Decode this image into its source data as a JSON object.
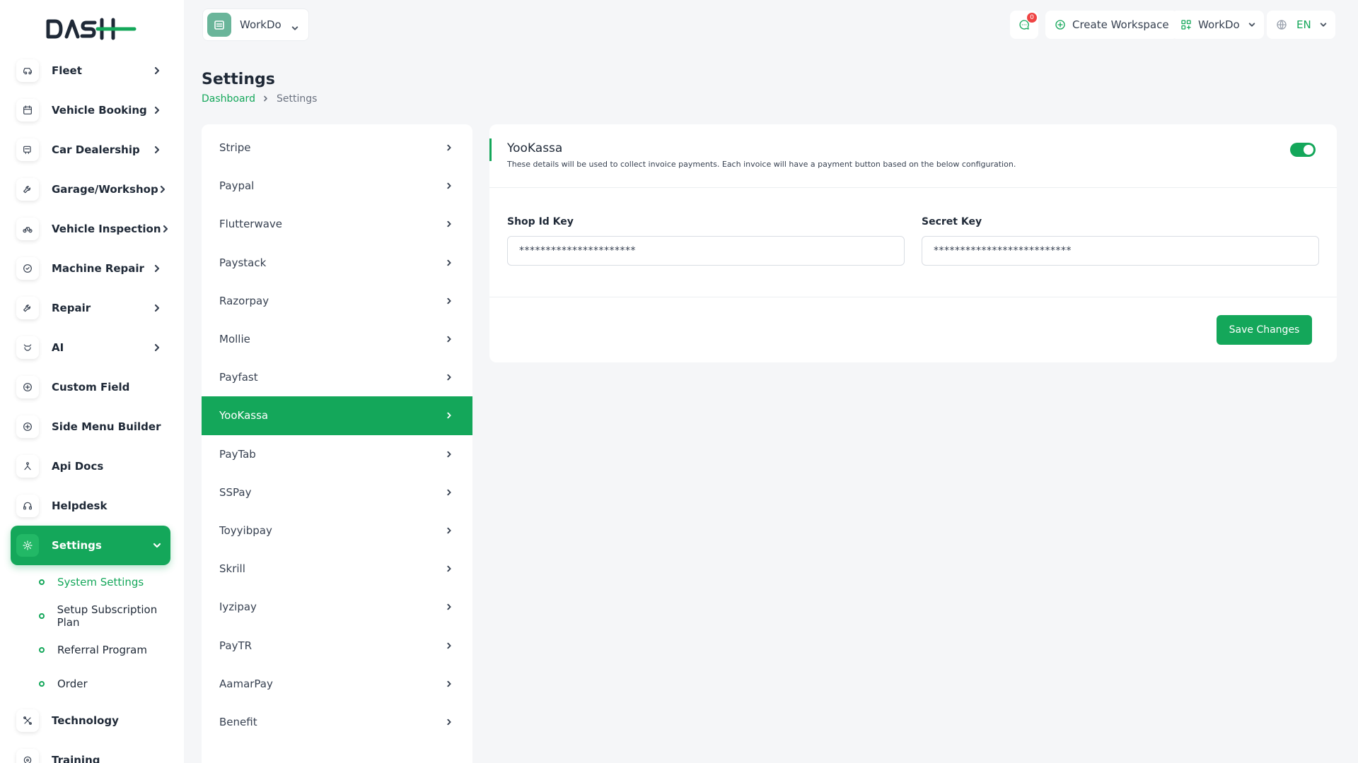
{
  "brand": {
    "logo_text": "DASH",
    "accent": "#14a75a"
  },
  "sidebar": {
    "items": [
      {
        "label": "Fleet",
        "icon": "car-icon",
        "has_children": true
      },
      {
        "label": "Vehicle Booking",
        "icon": "calendar-icon",
        "has_children": true
      },
      {
        "label": "Car Dealership",
        "icon": "dealership-icon",
        "has_children": true
      },
      {
        "label": "Garage/Workshop",
        "icon": "wrench-icon",
        "has_children": true
      },
      {
        "label": "Vehicle Inspection",
        "icon": "bike-icon",
        "has_children": true
      },
      {
        "label": "Machine Repair",
        "icon": "machine-icon",
        "has_children": true
      },
      {
        "label": "Repair",
        "icon": "repair-icon",
        "has_children": true
      },
      {
        "label": "AI",
        "icon": "ai-icon",
        "has_children": true
      },
      {
        "label": "Custom Field",
        "icon": "plus-circle-icon",
        "has_children": false
      },
      {
        "label": "Side Menu Builder",
        "icon": "plus-circle-icon",
        "has_children": false
      },
      {
        "label": "Api Docs",
        "icon": "api-icon",
        "has_children": false
      },
      {
        "label": "Helpdesk",
        "icon": "headset-icon",
        "has_children": false
      },
      {
        "label": "Settings",
        "icon": "gear-icon",
        "has_children": true,
        "active": true
      }
    ],
    "settings_sub": [
      {
        "label": "System Settings",
        "current": true
      },
      {
        "label": "Setup Subscription Plan"
      },
      {
        "label": "Referral Program"
      },
      {
        "label": "Order"
      }
    ],
    "after_items": [
      {
        "label": "Technology",
        "icon": "technology-icon"
      },
      {
        "label": "Training",
        "icon": "training-icon"
      }
    ]
  },
  "topbar": {
    "workspace_name": "WorkDo",
    "notification_count": "0",
    "create_workspace_label": "Create Workspace",
    "workspace_menu_label": "WorkDo",
    "language": "EN"
  },
  "page": {
    "title": "Settings",
    "breadcrumb": {
      "home": "Dashboard",
      "current": "Settings"
    }
  },
  "gateways": [
    "Stripe",
    "Paypal",
    "Flutterwave",
    "Paystack",
    "Razorpay",
    "Mollie",
    "Payfast",
    "YooKassa",
    "PayTab",
    "SSPay",
    "Toyyibpay",
    "Skrill",
    "Iyzipay",
    "PayTR",
    "AamarPay",
    "Benefit"
  ],
  "active_gateway": "YooKassa",
  "card": {
    "title": "YooKassa",
    "description": "These details will be used to collect invoice payments. Each invoice will have a payment button based on the below configuration.",
    "enabled": true,
    "shop_id": {
      "label": "Shop Id Key",
      "value": "**********************"
    },
    "secret": {
      "label": "Secret Key",
      "value": "**************************"
    },
    "save_label": "Save Changes"
  }
}
